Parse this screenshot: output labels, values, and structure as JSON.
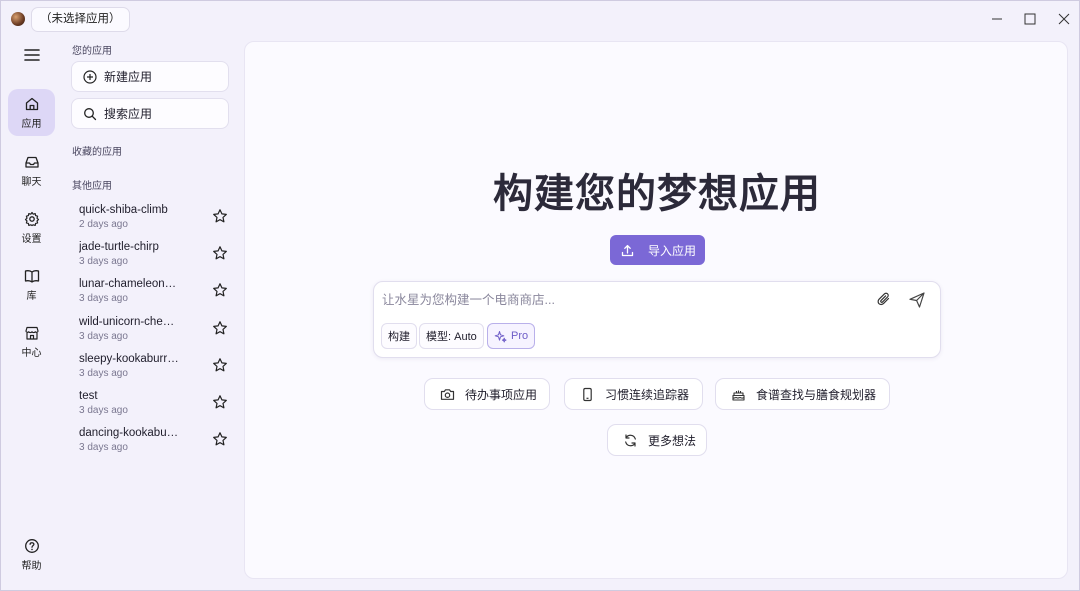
{
  "titlebar": {
    "app_selector": "（未选择应用）",
    "icons": [
      "app-logo",
      "minimize-icon",
      "maximize-icon",
      "close-icon"
    ]
  },
  "rail": {
    "items": [
      {
        "label": "应用",
        "icon": "home-icon",
        "active": true
      },
      {
        "label": "聊天",
        "icon": "inbox-icon"
      },
      {
        "label": "设置",
        "icon": "gear-icon"
      },
      {
        "label": "库",
        "icon": "book-icon"
      },
      {
        "label": "中心",
        "icon": "store-icon"
      }
    ],
    "help": {
      "label": "帮助",
      "icon": "help-icon"
    }
  },
  "panel": {
    "your_apps_title": "您的应用",
    "new_app_label": "新建应用",
    "search_app_label": "搜索应用",
    "favorites_title": "收藏的应用",
    "other_title": "其他应用",
    "apps": [
      {
        "name": "quick-shiba-climb",
        "time": "2 days ago"
      },
      {
        "name": "jade-turtle-chirp",
        "time": "3 days ago"
      },
      {
        "name": "lunar-chameleon…",
        "time": "3 days ago"
      },
      {
        "name": "wild-unicorn-che…",
        "time": "3 days ago"
      },
      {
        "name": "sleepy-kookaburr…",
        "time": "3 days ago"
      },
      {
        "name": "test",
        "time": "3 days ago"
      },
      {
        "name": "dancing-kookabu…",
        "time": "3 days ago"
      }
    ]
  },
  "main": {
    "title": "构建您的梦想应用",
    "import_label": "导入应用",
    "prompt_placeholder": "让水星为您构建一个电商商店...",
    "chips": {
      "build": "构建",
      "model": "模型: Auto",
      "pro": "Pro"
    },
    "suggestions": [
      {
        "label": "待办事项应用",
        "icon": "camera-icon"
      },
      {
        "label": "习惯连续追踪器",
        "icon": "phone-icon"
      },
      {
        "label": "食谱查找与膳食规划器",
        "icon": "cake-icon"
      },
      {
        "label": "更多想法",
        "icon": "refresh-icon"
      }
    ]
  },
  "colors": {
    "accent": "#7b68d6",
    "active_rail": "#ddd7f6",
    "background": "#f3f1fb"
  }
}
